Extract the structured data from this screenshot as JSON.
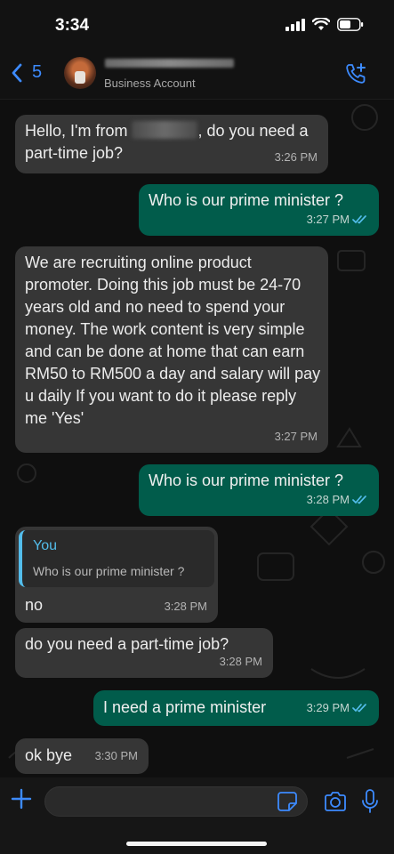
{
  "status_bar": {
    "time": "3:34"
  },
  "header": {
    "back_count": "5",
    "contact_subtitle": "Business Account"
  },
  "messages": [
    {
      "dir": "in",
      "text_prefix": "Hello, I'm from ",
      "text_suffix": ", do you need a part-time job?",
      "time": "3:26 PM"
    },
    {
      "dir": "out",
      "text": "Who is our prime minister ?",
      "time": "3:27 PM"
    },
    {
      "dir": "in",
      "text": "We are recruiting online product promoter. Doing this job must be 24-70 years old and no need to spend your money. The work content is very simple and can be done at home that can earn RM50 to RM500 a day and salary will pay u daily If you want to do it please reply me 'Yes'",
      "time": "3:27 PM"
    },
    {
      "dir": "out",
      "text": "Who is our prime minister ?",
      "time": "3:28 PM"
    },
    {
      "dir": "in",
      "quote_name": "You",
      "quote_text": "Who is our prime minister ?",
      "text": "no",
      "time": "3:28 PM"
    },
    {
      "dir": "in",
      "text": "do you need a part-time job?",
      "time": "3:28 PM"
    },
    {
      "dir": "out",
      "text": "I need a prime minister",
      "time": "3:29 PM"
    },
    {
      "dir": "in",
      "text": "ok bye",
      "time": "3:30 PM"
    }
  ],
  "composer": {
    "value": "",
    "placeholder": ""
  },
  "colors": {
    "accent": "#3d8bff",
    "outgoing": "#015c4b",
    "incoming": "#363636",
    "read_ticks": "#53bdeb"
  },
  "icons": [
    "back-chevron-icon",
    "add-call-icon",
    "plus-icon",
    "sticker-icon",
    "camera-icon",
    "mic-icon",
    "read-ticks-icon",
    "signal-icon",
    "wifi-icon",
    "battery-icon"
  ]
}
